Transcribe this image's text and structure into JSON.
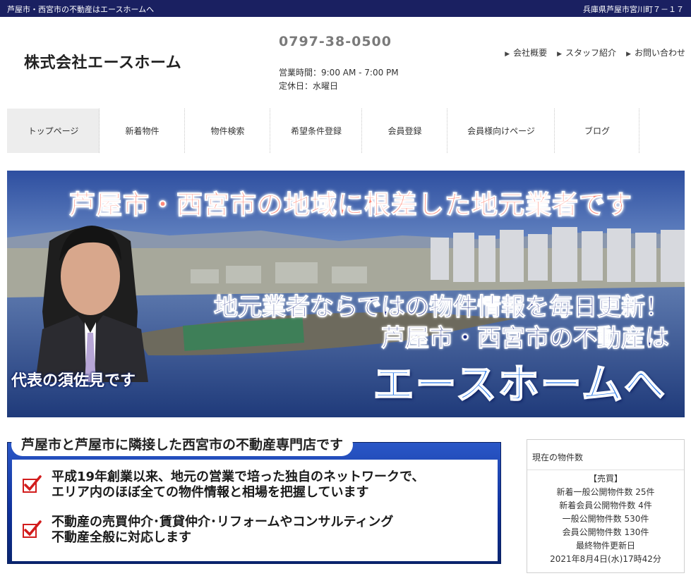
{
  "topbar": {
    "left": "芦屋市・西宮市の不動産はエースホームへ",
    "right": "兵庫県芦屋市宮川町７－１７"
  },
  "header": {
    "company": "株式会社エースホーム",
    "phone": "0797-38-0500",
    "hours": "営業時間：9:00 AM - 7:00 PM",
    "closed": "定休日：水曜日",
    "links": [
      "会社概要",
      "スタッフ紹介",
      "お問い合わせ"
    ]
  },
  "nav": {
    "items": [
      "トップページ",
      "新着物件",
      "物件検索",
      "希望条件登録",
      "会員登録",
      "会員様向けページ",
      "ブログ"
    ]
  },
  "banner": {
    "title": "芦屋市・西宮市の地域に根差した地元業者です",
    "line2": "地元業者ならではの物件情報を毎日更新！",
    "line3": "芦屋市・西宮市の不動産は",
    "big": "エースホームへ",
    "rep": "代表の須佐見です"
  },
  "info": {
    "heading": "芦屋市と芦屋市に隣接した西宮市の不動産専門店です",
    "points": [
      [
        "平成19年創業以来、地元の営業で培った独自のネットワークで、",
        "エリア内のほぼ全ての物件情報と相場を把握しています"
      ],
      [
        "不動産の売買仲介･賃貸仲介･リフォームやコンサルティング",
        "不動産全般に対応します"
      ]
    ]
  },
  "side": {
    "title": "現在の物件数",
    "lines": [
      "【売買】",
      "新着一般公開物件数 25件",
      "新着会員公開物件数 4件",
      "一般公開物件数 530件",
      "会員公開物件数 130件",
      "最終物件更新日",
      "2021年8月4日(水)17時42分"
    ]
  },
  "colors": {
    "topbar": "#1a2061",
    "accent_blue": "#2f7be8",
    "banner_title": "#ff8a7a",
    "check_red": "#d21c1c"
  }
}
